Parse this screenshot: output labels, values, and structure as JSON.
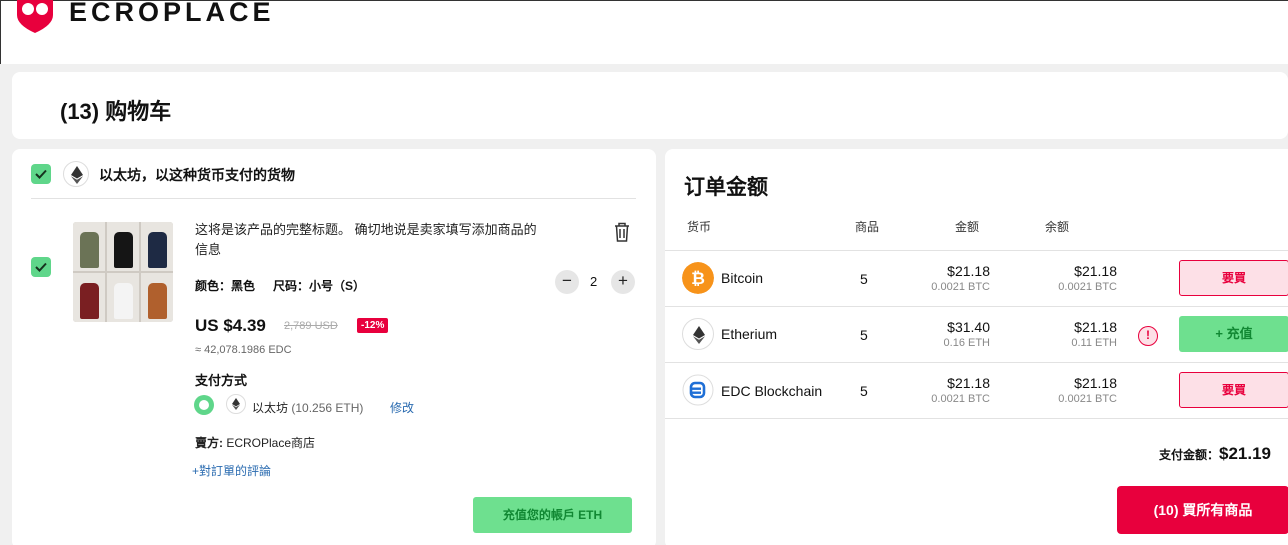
{
  "brand": {
    "name": "ECROPLACE",
    "color": "#e8003d"
  },
  "page": {
    "title": "(13) 购物车"
  },
  "cart_group": {
    "label": "以太坊，以这种货币支付的货物",
    "icon": "ethereum-icon",
    "item": {
      "title": "这将是该产品的完整标题。 确切地说是卖家填写添加商品的信息",
      "color_label": "颜色：黑色",
      "size_label": "尺码：小号（S）",
      "quantity": "2",
      "price": "US $4.39",
      "original_price": "2,789 USD",
      "discount": "-12%",
      "approx": "≈ 42,078.1986 EDC",
      "payment_label": "支付方式",
      "payment_method": "以太坊",
      "payment_balance": "(10.256 ETH)",
      "modify": "修改",
      "seller_label": "賣方:",
      "seller_name": "ECROPlace商店",
      "comment_link": "+對訂單的評論",
      "topup_button": "充值您的帳戶 ETH"
    }
  },
  "summary": {
    "title": "订单金额",
    "headers": {
      "currency": "货币",
      "items": "商品",
      "amount": "金额",
      "balance": "余额"
    },
    "rows": [
      {
        "name": "Bitcoin",
        "icon": "bitcoin-icon",
        "items": "5",
        "amount": "$21.18",
        "amount_sub": "0.0021 BTC",
        "balance": "$21.18",
        "balance_sub": "0.0021 BTC",
        "action": "要買"
      },
      {
        "name": "Etherium",
        "icon": "ethereum-icon",
        "items": "5",
        "amount": "$31.40",
        "amount_sub": "0.16 ETH",
        "balance": "$21.18",
        "balance_sub": "0.11 ETH",
        "action": "+ 充值",
        "warning": "!"
      },
      {
        "name": "EDC Blockchain",
        "icon": "edc-icon",
        "items": "5",
        "amount": "$21.18",
        "amount_sub": "0.0021 BTC",
        "balance": "$21.18",
        "balance_sub": "0.0021 BTC",
        "action": "要買"
      }
    ],
    "total_label": "支付金额：",
    "total_value": "$21.19",
    "buy_all": "(10) 買所有商品"
  }
}
